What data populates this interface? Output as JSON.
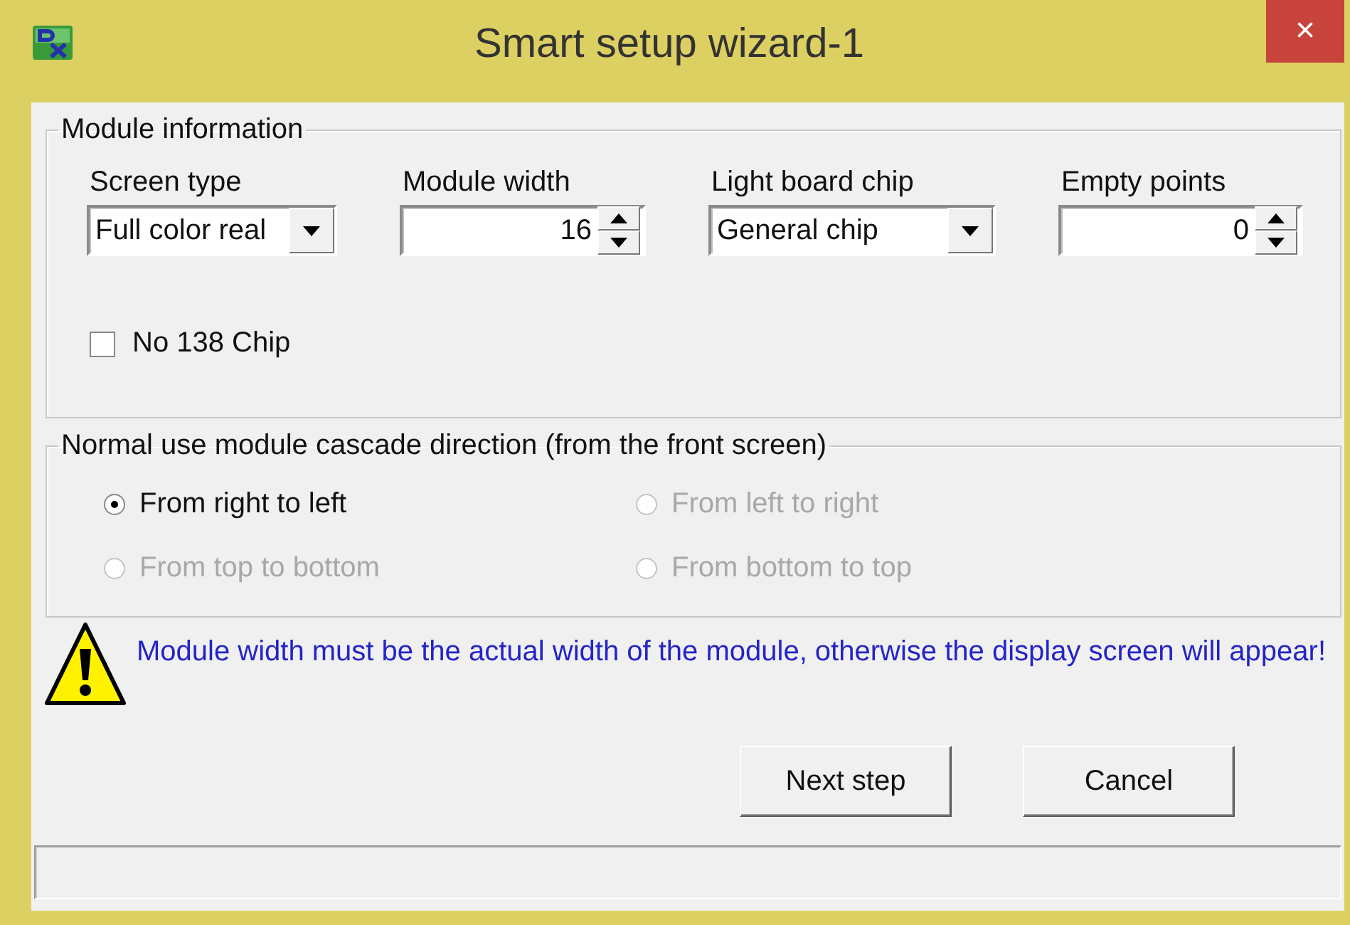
{
  "window": {
    "title": "Smart setup wizard-1",
    "close_glyph": "×"
  },
  "module_information": {
    "title": "Module information",
    "fields": [
      {
        "kind": "dropdown",
        "label": "Screen type",
        "value": "Full color real"
      },
      {
        "kind": "spinner",
        "label": "Module width",
        "value": "16"
      },
      {
        "kind": "dropdown",
        "label": "Light board chip",
        "value": "General chip"
      },
      {
        "kind": "spinner",
        "label": "Empty points",
        "value": "0"
      }
    ],
    "checkbox": {
      "label": "No 138 Chip",
      "checked": false
    }
  },
  "cascade_direction": {
    "title": "Normal use module cascade direction (from the front screen)",
    "options": [
      {
        "label": "From right to left",
        "selected": true,
        "disabled": false
      },
      {
        "label": "From left to right",
        "selected": false,
        "disabled": true
      },
      {
        "label": "From top to bottom",
        "selected": false,
        "disabled": true
      },
      {
        "label": "From bottom to top",
        "selected": false,
        "disabled": true
      }
    ]
  },
  "warning": {
    "text": "Module width must be the actual width of the module, otherwise the display screen will appear!"
  },
  "buttons": [
    "Next step",
    "Cancel"
  ]
}
